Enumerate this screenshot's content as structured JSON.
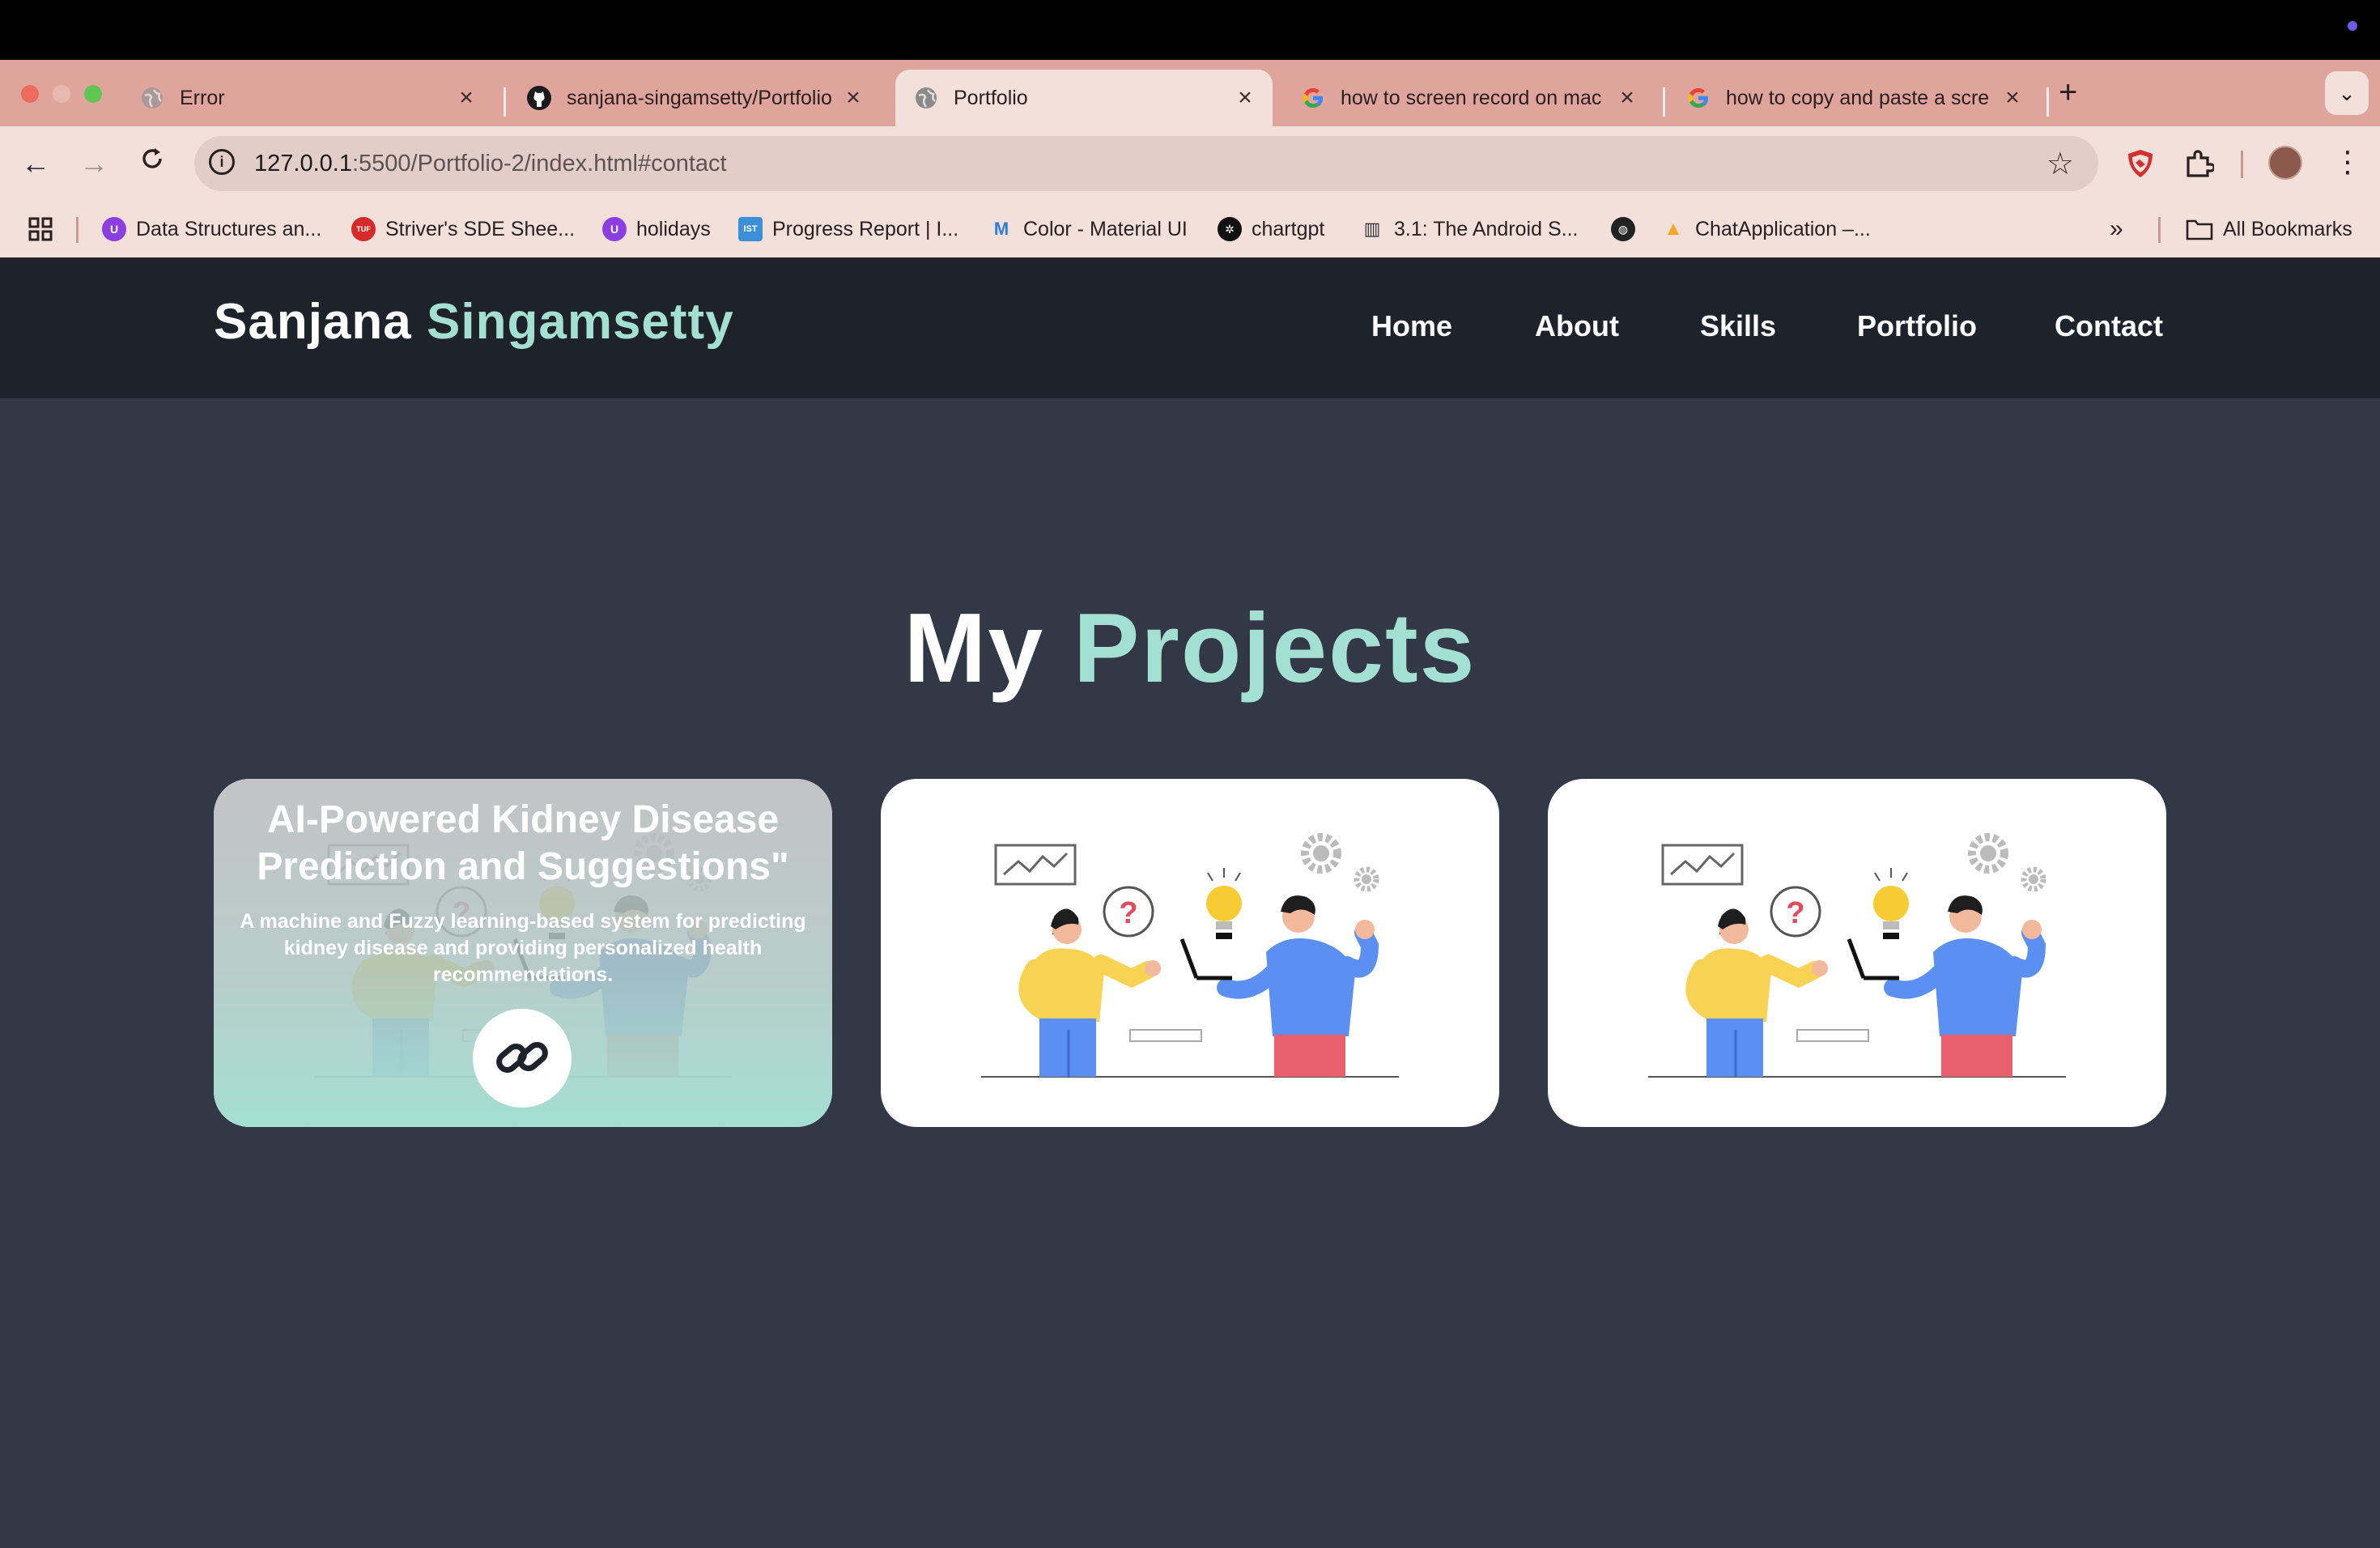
{
  "browser": {
    "tabs": [
      {
        "title": "Error",
        "favicon": "globe-icon",
        "active": false
      },
      {
        "title": "sanjana-singamsetty/Portfolio",
        "favicon": "github-icon",
        "active": false
      },
      {
        "title": "Portfolio",
        "favicon": "globe-icon",
        "active": true
      },
      {
        "title": "how to screen record on mac",
        "favicon": "google-icon",
        "active": false
      },
      {
        "title": "how to copy and paste a scre",
        "favicon": "google-icon",
        "active": false
      }
    ],
    "address": {
      "host": "127.0.0.1",
      "rest": ":5500/Portfolio-2/index.html#contact"
    },
    "bookmarks": [
      {
        "label": "Data Structures an...",
        "icon": "purple-u-icon",
        "color": "#8b3fe0"
      },
      {
        "label": "Striver's SDE Shee...",
        "icon": "tuf-icon",
        "color": "#d42a2a"
      },
      {
        "label": "holidays",
        "icon": "purple-u-icon",
        "color": "#8b3fe0"
      },
      {
        "label": "Progress Report | I...",
        "icon": "ist-icon",
        "color": "#3b8fd8"
      },
      {
        "label": "Color - Material UI",
        "icon": "mui-icon",
        "color": "#2b7bd8"
      },
      {
        "label": "chartgpt",
        "icon": "openai-icon",
        "color": "#111111"
      },
      {
        "label": "3.1: The Android S...",
        "icon": "book-icon",
        "color": "#333333"
      },
      {
        "label": "",
        "icon": "globe-icon",
        "color": "#222222"
      },
      {
        "label": "ChatApplication –...",
        "icon": "firebase-icon",
        "color": "#f5a623"
      }
    ],
    "all_bookmarks_label": "All Bookmarks"
  },
  "site": {
    "logo": {
      "first": "Sanjana",
      "second": "Singamsetty"
    },
    "nav": [
      "Home",
      "About",
      "Skills",
      "Portfolio",
      "Contact"
    ],
    "section_title": {
      "first": "My",
      "second": "Projects"
    },
    "projects": [
      {
        "title": "AI-Powered Kidney Disease Prediction and Suggestions\"",
        "description": "A machine and Fuzzy learning-based system for predicting kidney disease and providing personalized health recommendations.",
        "link_icon": "link-icon",
        "hovered": true
      },
      {
        "title": "",
        "description": "",
        "hovered": false
      },
      {
        "title": "",
        "description": "",
        "hovered": false
      }
    ]
  },
  "colors": {
    "accent": "#a4dfd3",
    "header_bg": "#1e222b",
    "page_bg": "#323846",
    "tabstrip_bg": "#dfa49b",
    "toolbar_bg": "#f3e0db"
  }
}
